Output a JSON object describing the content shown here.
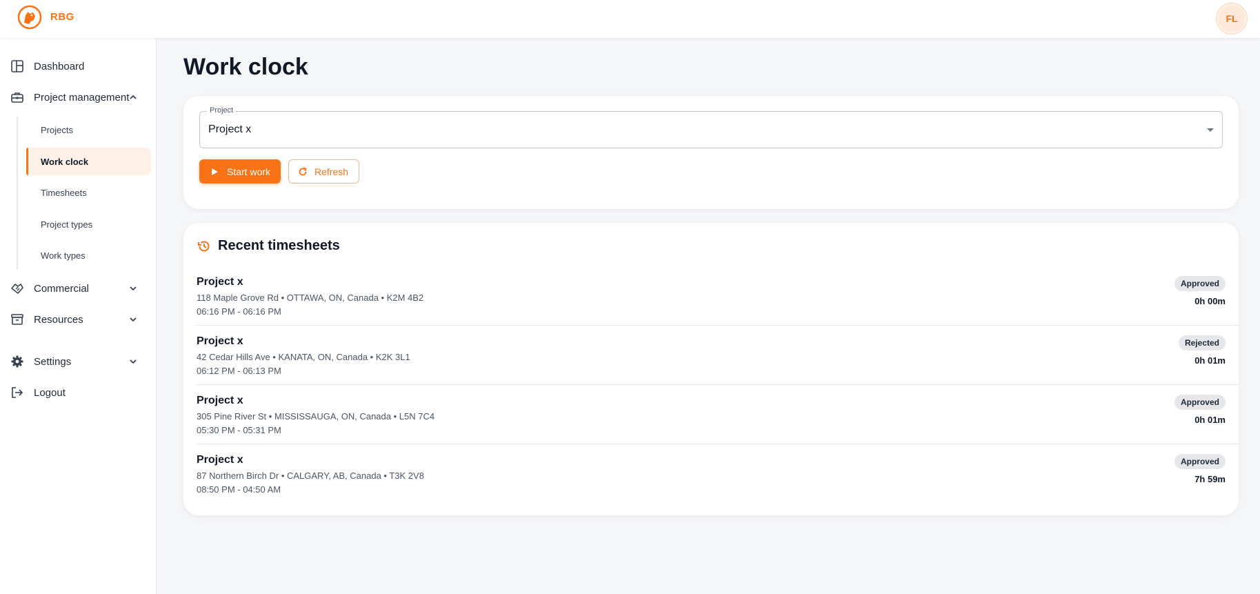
{
  "app": {
    "brand": "RBG",
    "user_initials": "FL"
  },
  "sidebar": {
    "items": [
      {
        "label": "Dashboard"
      },
      {
        "label": "Project management"
      },
      {
        "label": "Commercial"
      },
      {
        "label": "Resources"
      },
      {
        "label": "Settings"
      },
      {
        "label": "Logout"
      }
    ],
    "sub_items": [
      {
        "label": "Projects"
      },
      {
        "label": "Work clock"
      },
      {
        "label": "Timesheets"
      },
      {
        "label": "Project types"
      },
      {
        "label": "Work types"
      }
    ]
  },
  "main": {
    "title": "Work clock",
    "project_select": {
      "label": "Project",
      "value": "Project x"
    },
    "buttons": {
      "start": "Start work",
      "refresh": "Refresh"
    },
    "recent": {
      "title": "Recent timesheets",
      "rows": [
        {
          "title": "Project x",
          "address": "118 Maple Grove Rd • OTTAWA, ON, Canada • K2M 4B2",
          "time": "06:16 PM - 06:16 PM",
          "status": "Approved",
          "duration": "0h 00m"
        },
        {
          "title": "Project x",
          "address": "42 Cedar Hills Ave • KANATA, ON, Canada • K2K 3L1",
          "time": "06:12 PM - 06:13 PM",
          "status": "Rejected",
          "duration": "0h 01m"
        },
        {
          "title": "Project x",
          "address": "305 Pine River St • MISSISSAUGA, ON, Canada • L5N 7C4",
          "time": "05:30 PM - 05:31 PM",
          "status": "Approved",
          "duration": "0h 01m"
        },
        {
          "title": "Project x",
          "address": "87 Northern Birch Dr • CALGARY, AB, Canada • T3K 2V8",
          "time": "08:50 PM - 04:50 AM",
          "status": "Approved",
          "duration": "7h 59m"
        }
      ]
    }
  },
  "colors": {
    "accent": "#f97316",
    "accent_soft": "#fff1e8",
    "background": "#f5f6f8"
  }
}
